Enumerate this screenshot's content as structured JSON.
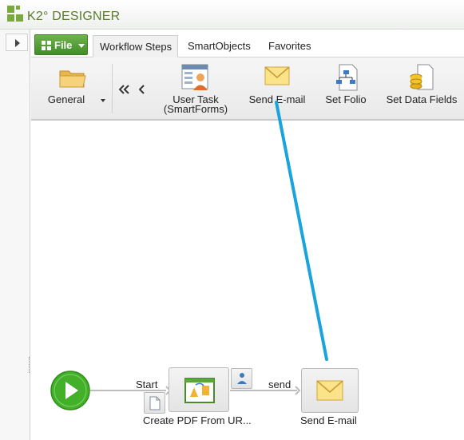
{
  "app": {
    "title": "K2° DESIGNER"
  },
  "left_panel": {
    "expand_icon": "triangle-right-icon"
  },
  "file_menu": {
    "label": "File",
    "icon": "apps-grid-icon"
  },
  "tabs": [
    {
      "label": "Workflow Steps",
      "active": true
    },
    {
      "label": "SmartObjects",
      "active": false
    },
    {
      "label": "Favorites",
      "active": false
    }
  ],
  "ribbon": {
    "general": {
      "label": "General",
      "icon": "folder-icon"
    },
    "items": [
      {
        "label_line1": "User Task",
        "label_line2": "(SmartForms)",
        "icon": "user-task-form-icon"
      },
      {
        "label_line1": "Send E-mail",
        "icon": "envelope-icon"
      },
      {
        "label_line1": "Set Folio",
        "icon": "org-chart-document-icon"
      },
      {
        "label_line1": "Set Data Fields",
        "icon": "database-document-icon"
      }
    ]
  },
  "canvas": {
    "start": {
      "label": "Start",
      "icon": "play-icon"
    },
    "step1": {
      "label": "Create PDF From UR...",
      "icon": "document-convert-icon"
    },
    "send": {
      "connector_label": "send"
    },
    "step2": {
      "label": "Send E-mail",
      "icon": "envelope-icon"
    }
  },
  "colors": {
    "accent": "#3f8d2a",
    "drag_line": "#1aa3dd",
    "start_green": "#43b02a"
  }
}
